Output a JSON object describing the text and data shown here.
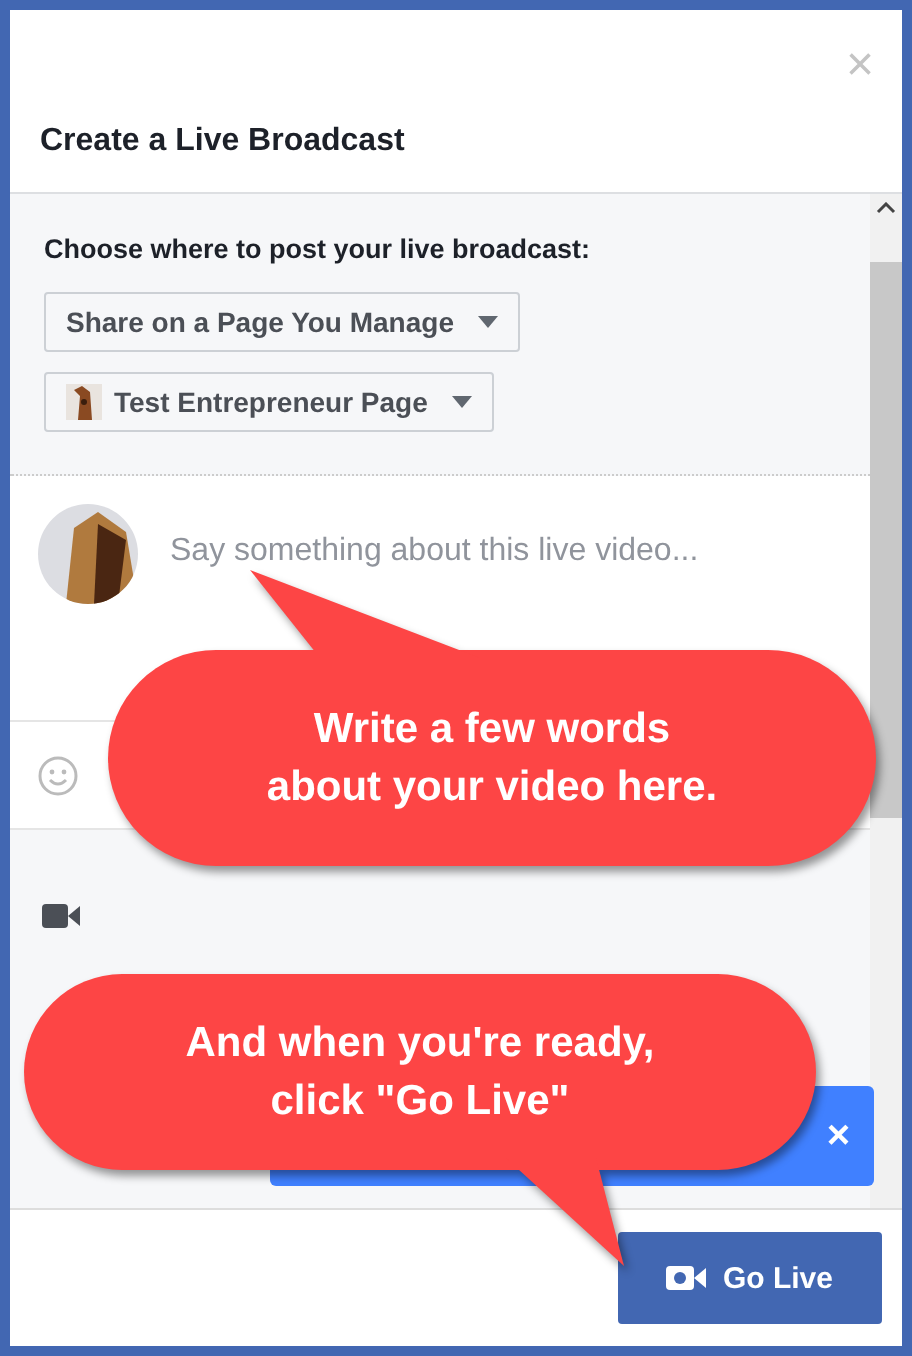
{
  "dialog": {
    "title": "Create a Live Broadcast",
    "close": "×"
  },
  "audience": {
    "label": "Choose where to post your live broadcast:",
    "dropdowns": [
      {
        "kind": "plain",
        "text": "Share on a Page You Manage"
      },
      {
        "kind": "page",
        "text": "Test Entrepreneur Page"
      }
    ]
  },
  "composer": {
    "placeholder": "Say something about this live video..."
  },
  "tooltip": {
    "close": "×"
  },
  "go_live": {
    "label": "Go Live"
  },
  "callouts": [
    {
      "kind": "up",
      "lines": [
        "Write a few words",
        "about your video here."
      ]
    },
    {
      "kind": "down",
      "lines": [
        "And when you're ready,",
        "click \"Go Live\""
      ]
    }
  ]
}
